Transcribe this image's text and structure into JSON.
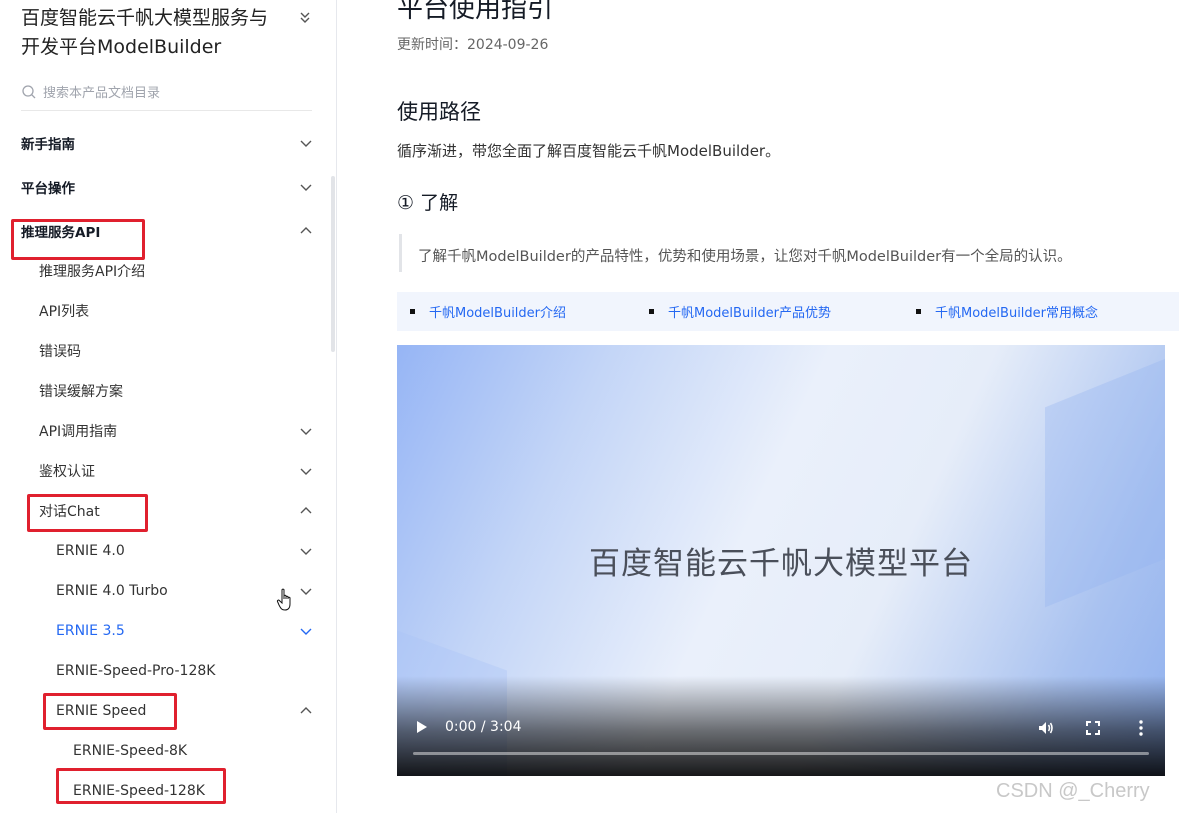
{
  "sidebar": {
    "doc_title": "百度智能云千帆大模型服务与开发平台ModelBuilder",
    "search_placeholder": "搜索本产品文档目录",
    "items": [
      {
        "label": "新手指南",
        "chevron": "down"
      },
      {
        "label": "平台操作",
        "chevron": "down"
      },
      {
        "label": "推理服务API",
        "chevron": "up"
      },
      {
        "label": "推理服务API介绍"
      },
      {
        "label": "API列表"
      },
      {
        "label": "错误码"
      },
      {
        "label": "错误缓解方案"
      },
      {
        "label": "API调用指南",
        "chevron": "down"
      },
      {
        "label": "鉴权认证",
        "chevron": "down"
      },
      {
        "label": "对话Chat",
        "chevron": "up"
      },
      {
        "label": "ERNIE 4.0",
        "chevron": "down"
      },
      {
        "label": "ERNIE 4.0 Turbo",
        "chevron": "down"
      },
      {
        "label": "ERNIE 3.5",
        "chevron": "down",
        "active": true
      },
      {
        "label": "ERNIE-Speed-Pro-128K"
      },
      {
        "label": "ERNIE Speed",
        "chevron": "up"
      },
      {
        "label": "ERNIE-Speed-8K"
      },
      {
        "label": "ERNIE-Speed-128K"
      }
    ]
  },
  "main": {
    "page_title": "平台使用指引",
    "updated": "更新时间：2024-09-26",
    "section_title": "使用路径",
    "intro": "循序渐进，带您全面了解百度智能云千帆ModelBuilder。",
    "step_title": "① 了解",
    "quote": "了解千帆ModelBuilder的产品特性，优势和使用场景，让您对千帆ModelBuilder有一个全局的认识。",
    "links": [
      "千帆ModelBuilder介绍",
      "千帆ModelBuilder产品优势",
      "千帆ModelBuilder常用概念"
    ],
    "video": {
      "title": "百度智能云千帆大模型平台",
      "time": "0:00 / 3:04",
      "progress": 0
    }
  },
  "watermark": "CSDN @_Cherry",
  "colors": {
    "accent": "#2468f2",
    "highlight_box": "#e0202e"
  }
}
